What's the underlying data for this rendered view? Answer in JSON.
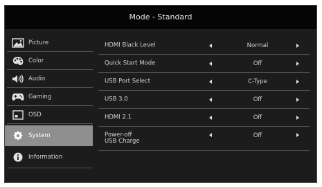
{
  "header": {
    "title": "Mode - Standard"
  },
  "menu": {
    "items": [
      {
        "label": "Picture",
        "icon": "picture-icon"
      },
      {
        "label": "Color",
        "icon": "palette-icon"
      },
      {
        "label": "Audio",
        "icon": "speaker-icon"
      },
      {
        "label": "Gaming",
        "icon": "gamepad-icon"
      },
      {
        "label": "OSD",
        "icon": "osd-icon"
      },
      {
        "label": "System",
        "icon": "gear-icon",
        "selected": true
      },
      {
        "label": "Information",
        "icon": "info-icon"
      }
    ]
  },
  "settings": {
    "rows": [
      {
        "label": "HDMI Black Level",
        "value": "Normal"
      },
      {
        "label": "Quick Start Mode",
        "value": "Off"
      },
      {
        "label": "USB Port Select",
        "value": "C-Type"
      },
      {
        "label": "USB 3.0",
        "value": "Off"
      },
      {
        "label": "HDMI 2.1",
        "value": "Off"
      },
      {
        "label": "Power-off",
        "label2": "USB Charge",
        "value": "Off"
      }
    ]
  },
  "colors": {
    "selected_bg": "#8f8f8f",
    "panel_bg": "#1c1c1c",
    "title_bg": "#050505"
  }
}
